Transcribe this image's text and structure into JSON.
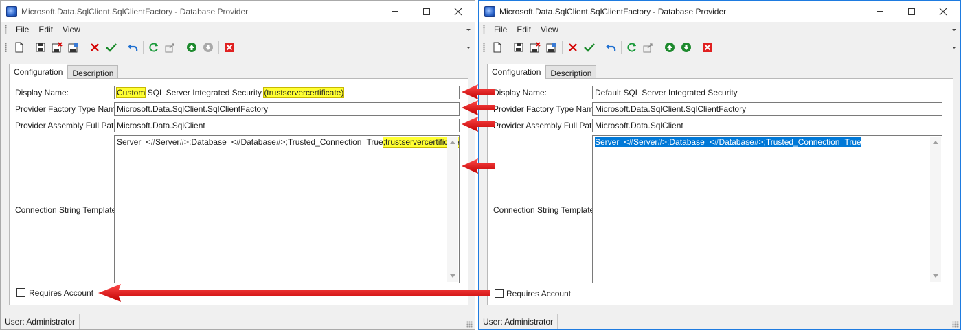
{
  "left_window": {
    "title": "Microsoft.Data.SqlClient.SqlClientFactory - Database Provider",
    "menu": [
      "File",
      "Edit",
      "View"
    ],
    "tabs": [
      "Configuration",
      "Description"
    ],
    "form": {
      "display_name_label": "Display Name:",
      "display_name_part1": "Custom",
      "display_name_part2": " SQL Server Integrated Security ",
      "display_name_part3": "(trustservercertificate)",
      "provider_factory_label": "Provider Factory Type Name:",
      "provider_factory_value": "Microsoft.Data.SqlClient.SqlClientFactory",
      "assembly_label": "Provider Assembly Full Path:",
      "assembly_value": "Microsoft.Data.SqlClient",
      "conn_label": "Connection String Template:",
      "conn_value_part1": "Server=<#Server#>;Database=<#Database#>;Trusted_Connection=True",
      "conn_value_part2": ";trustservercertificate=true",
      "requires_account_label": "Requires Account",
      "requires_account_checked": false
    },
    "status": "User: Administrator"
  },
  "right_window": {
    "title": "Microsoft.Data.SqlClient.SqlClientFactory - Database Provider",
    "menu": [
      "File",
      "Edit",
      "View"
    ],
    "tabs": [
      "Configuration",
      "Description"
    ],
    "form": {
      "display_name_label": "Display Name:",
      "display_name_value": "Default SQL Server Integrated Security",
      "provider_factory_label": "Provider Factory Type Name:",
      "provider_factory_value": "Microsoft.Data.SqlClient.SqlClientFactory",
      "assembly_label": "Provider Assembly Full Path:",
      "assembly_value": "Microsoft.Data.SqlClient",
      "conn_label": "Connection String Template:",
      "conn_value": "Server=<#Server#>;Database=<#Database#>;Trusted_Connection=True",
      "requires_account_label": "Requires Account",
      "requires_account_checked": false
    },
    "status": "User: Administrator"
  },
  "toolbar_icons": [
    "new-icon",
    "save-icon",
    "save-delete-icon",
    "save-copy-icon",
    "delete-icon",
    "accept-icon",
    "undo-icon",
    "refresh-icon",
    "export-icon",
    "move-up-icon",
    "move-down-icon",
    "close-red-icon"
  ],
  "colors": {
    "highlight": "#ffff33",
    "selection": "#0078d7",
    "annotation_arrow": "#e00000",
    "active_border": "#1e7be0"
  }
}
